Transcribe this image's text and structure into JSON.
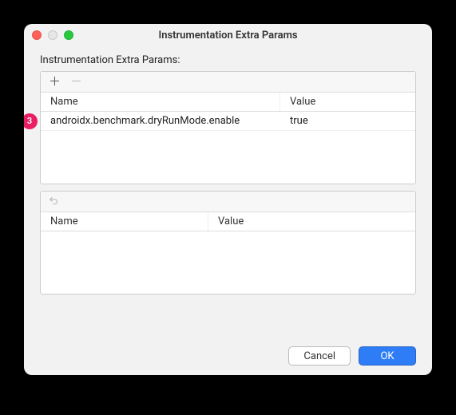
{
  "window": {
    "title": "Instrumentation Extra Params"
  },
  "section": {
    "label": "Instrumentation Extra Params:"
  },
  "table1": {
    "headers": {
      "name": "Name",
      "value": "Value"
    },
    "rows": [
      {
        "name": "androidx.benchmark.dryRunMode.enable",
        "value": "true"
      }
    ]
  },
  "table2": {
    "headers": {
      "name": "Name",
      "value": "Value"
    }
  },
  "annotation": {
    "badge": "3"
  },
  "buttons": {
    "cancel": "Cancel",
    "ok": "OK"
  }
}
